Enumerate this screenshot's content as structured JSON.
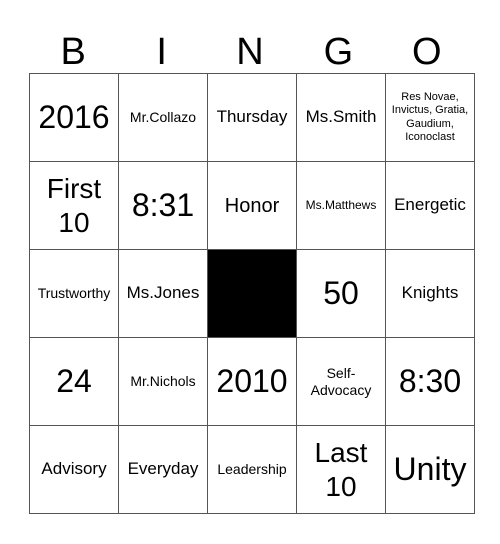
{
  "header": [
    "B",
    "I",
    "N",
    "G",
    "O"
  ],
  "board": [
    [
      "2016",
      "Mr.Collazo",
      "Thursday",
      "Ms.Smith",
      "Res Novae, Invictus, Gratia, Gaudium, Iconoclast"
    ],
    [
      "First 10",
      "8:31",
      "Honor",
      "Ms.Matthews",
      "Energetic"
    ],
    [
      "Trustworthy",
      "Ms.Jones",
      "",
      "50",
      "Knights"
    ],
    [
      "24",
      "Mr.Nichols",
      "2010",
      "Self-Advocacy",
      "8:30"
    ],
    [
      "Advisory",
      "Everyday",
      "Leadership",
      "Last 10",
      "Unity"
    ]
  ],
  "free_space": {
    "row": 2,
    "col": 2,
    "color": "#000000"
  }
}
